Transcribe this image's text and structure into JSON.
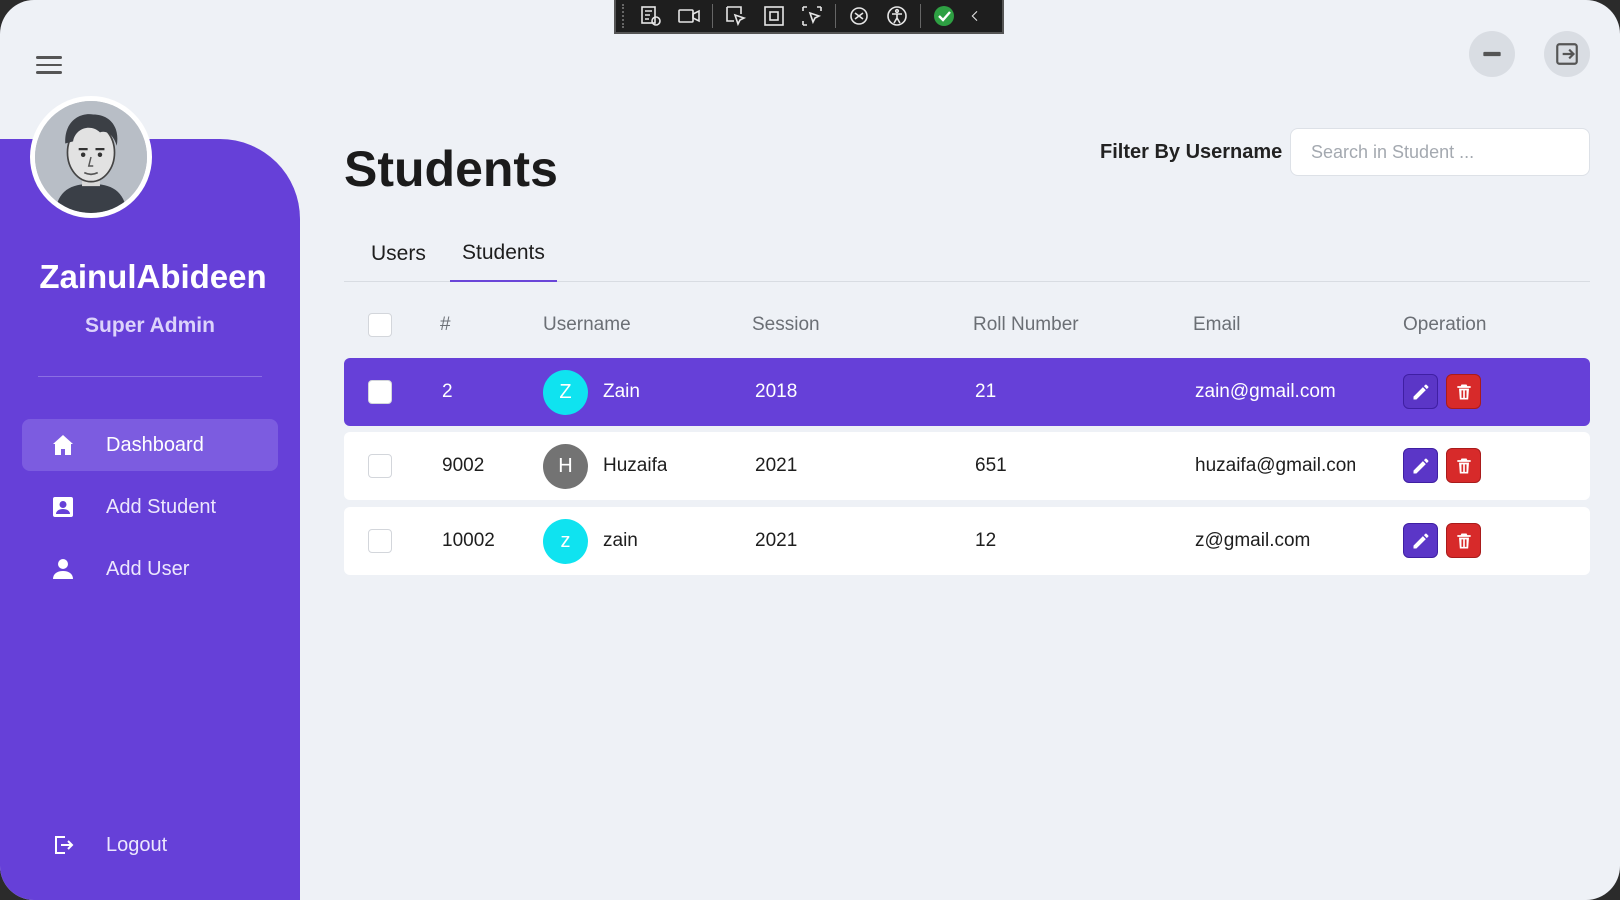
{
  "colors": {
    "primary": "#6640d8",
    "accent_cyan": "#0fe3f0",
    "danger": "#d72a2a",
    "badge_grey": "#737373"
  },
  "sidebar": {
    "user_name": "ZainulAbideen",
    "user_role": "Super Admin",
    "items": [
      {
        "label": "Dashboard",
        "icon": "home-icon",
        "active": true
      },
      {
        "label": "Add Student",
        "icon": "contact-card-icon",
        "active": false
      },
      {
        "label": "Add User",
        "icon": "person-icon",
        "active": false
      }
    ],
    "logout_label": "Logout"
  },
  "header": {
    "title": "Students",
    "filter_label": "Filter By Username",
    "search_placeholder": "Search in Student ..."
  },
  "tabs": [
    {
      "label": "Users",
      "active": false
    },
    {
      "label": "Students",
      "active": true
    }
  ],
  "table": {
    "columns": [
      "#",
      "Username",
      "Session",
      "Roll Number",
      "Email",
      "Operation"
    ],
    "rows": [
      {
        "id": "2",
        "initial": "Z",
        "username": "Zain",
        "session": "2018",
        "roll": "21",
        "email": "zain@gmail.com",
        "selected": true
      },
      {
        "id": "9002",
        "initial": "H",
        "username": "Huzaifa",
        "session": "2021",
        "roll": "651",
        "email": "huzaifa@gmail.com",
        "selected": false
      },
      {
        "id": "10002",
        "initial": "z",
        "username": "zain",
        "session": "2021",
        "roll": "12",
        "email": "z@gmail.com",
        "selected": false
      }
    ]
  }
}
